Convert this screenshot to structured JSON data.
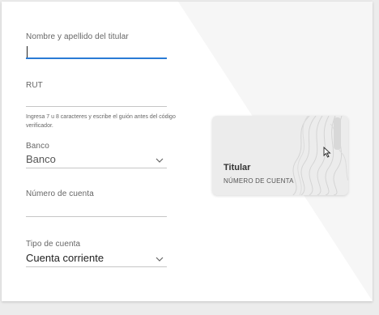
{
  "form": {
    "name_label": "Nombre y apellido del titular",
    "name_value": "",
    "rut_label": "RUT",
    "rut_helper": "Ingresa 7 u 8 caracteres y escribe el guión antes del código verificador.",
    "bank_label": "Banco",
    "bank_value": "Banco",
    "account_number_label": "Número de cuenta",
    "account_number_value": "",
    "account_type_label": "Tipo de cuenta",
    "account_type_value": "Cuenta corriente"
  },
  "card": {
    "holder": "Titular",
    "number": "NÚMERO DE CUENTA"
  },
  "colors": {
    "accent": "#2a7bd5",
    "card_bg": "#ececec"
  }
}
